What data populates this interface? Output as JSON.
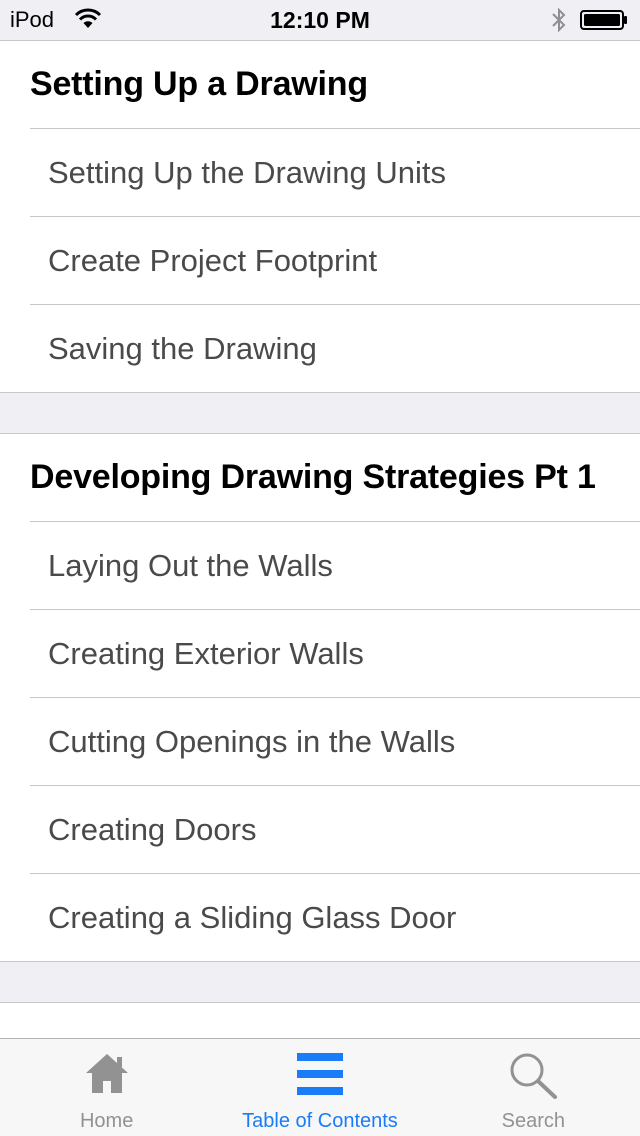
{
  "status_bar": {
    "carrier": "iPod",
    "time": "12:10 PM"
  },
  "sections": [
    {
      "title": "Setting Up a Drawing",
      "items": [
        "Setting Up the Drawing Units",
        "Create Project Footprint",
        "Saving the Drawing"
      ]
    },
    {
      "title": "Developing Drawing Strategies Pt 1",
      "items": [
        "Laying Out the Walls",
        "Creating Exterior Walls",
        "Cutting Openings in the Walls",
        "Creating Doors",
        "Creating a Sliding Glass Door"
      ]
    }
  ],
  "tab_bar": {
    "home_label": "Home",
    "toc_label": "Table of Contents",
    "search_label": "Search"
  },
  "colors": {
    "accent": "#1a7cf6",
    "inactive": "#929292",
    "group_background": "#efeff4"
  }
}
